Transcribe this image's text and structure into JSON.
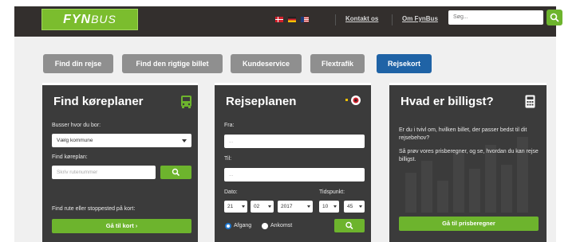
{
  "header": {
    "logo_main": "FYN",
    "logo_sub": "BUS",
    "link_contact": "Kontakt os",
    "link_about": "Om FynBus",
    "search_placeholder": "Søg..."
  },
  "tabs": [
    {
      "label": "Find din rejse"
    },
    {
      "label": "Find den rigtige billet"
    },
    {
      "label": "Kundeservice"
    },
    {
      "label": "Flextrafik"
    },
    {
      "label": "Rejsekort"
    }
  ],
  "koreplaner": {
    "title": "Find køreplaner",
    "busser_label": "Busser hvor du bor:",
    "kommune_value": "Vælg kommune",
    "find_label": "Find køreplan:",
    "rute_placeholder": "Skriv rutenummer",
    "kort_label": "Find rute eller stoppested på kort:",
    "kort_button": "Gå til kort"
  },
  "rejseplanen": {
    "title": "Rejseplanen",
    "fra_label": "Fra:",
    "til_label": "Til:",
    "dato_label": "Dato:",
    "tid_label": "Tidspunkt:",
    "day": "21",
    "month": "02",
    "year": "2017",
    "hour": "10",
    "minute": "45",
    "afgang": "Afgang",
    "ankomst": "Ankomst"
  },
  "billigst": {
    "title": "Hvad er billigst?",
    "text1": "Er du i tvivl om, hvilken billet, der passer bedst til dit rejsebehov?",
    "text2": "Så prøv vores prisberegner, og se, hvordan du kan rejse billigst.",
    "button": "Gå til prisberegner"
  },
  "colors": {
    "accent_green": "#6db42d",
    "active_tab": "#1f63a6",
    "panel_dark": "#3b3b3b"
  }
}
